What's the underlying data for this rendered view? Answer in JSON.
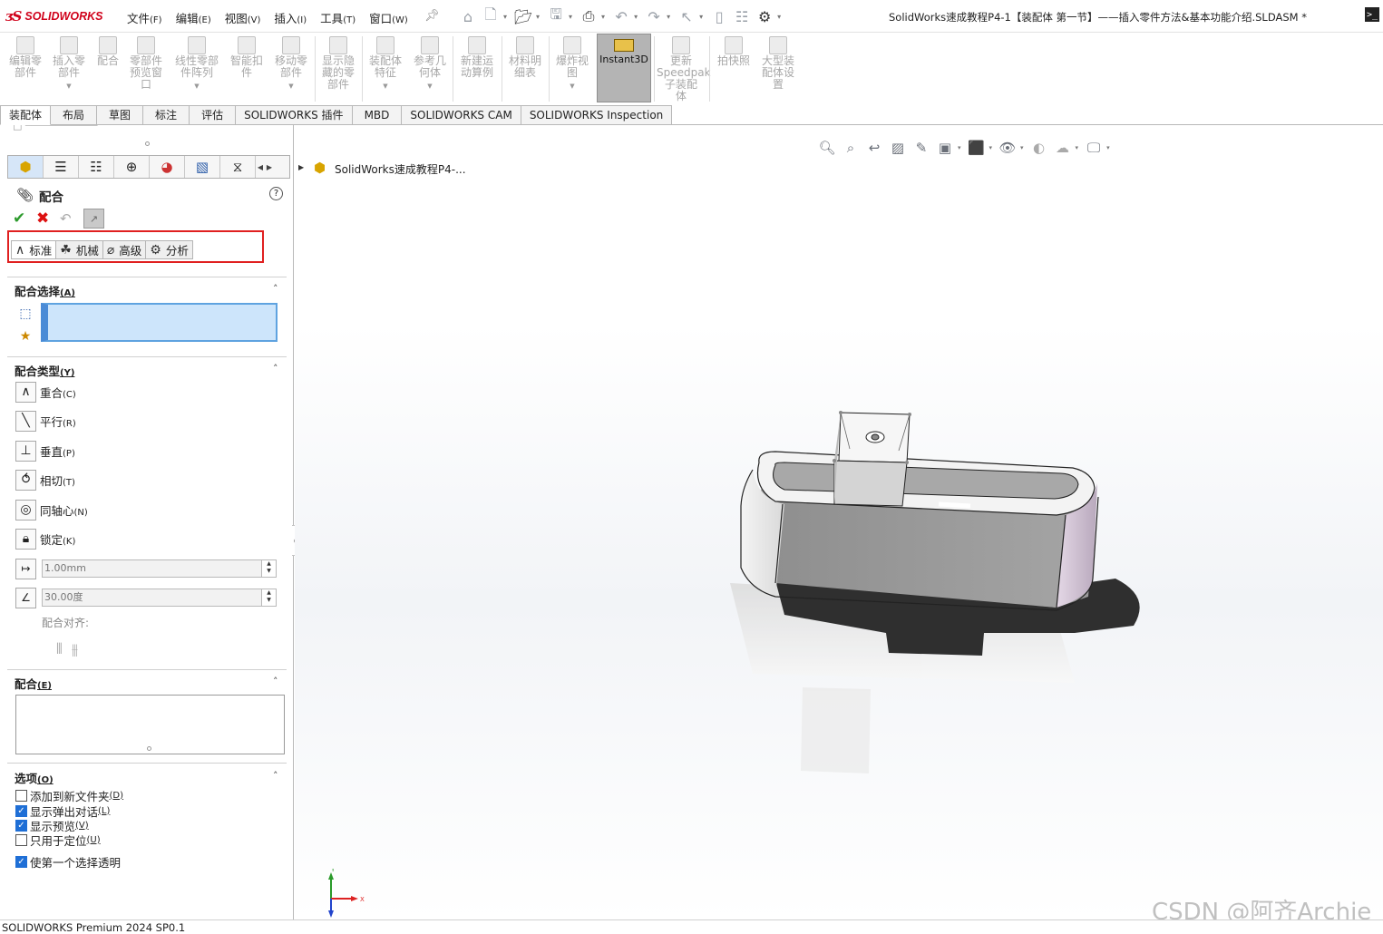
{
  "app": {
    "logo_mark": "ᴣS",
    "logo_text": "SOLIDWORKS",
    "title": "SolidWorks速成教程P4-1【装配体  第一节】——插入零件方法&基本功能介绍.SLDASM *"
  },
  "menu": {
    "items": [
      {
        "label": "文件",
        "accel": "(F)"
      },
      {
        "label": "编辑",
        "accel": "(E)"
      },
      {
        "label": "视图",
        "accel": "(V)"
      },
      {
        "label": "插入",
        "accel": "(I)"
      },
      {
        "label": "工具",
        "accel": "(T)"
      },
      {
        "label": "窗口",
        "accel": "(W)"
      }
    ]
  },
  "ribbon": {
    "buttons": [
      {
        "label": "编辑零\n部件",
        "icon": "edit-component-icon",
        "dropdown": false
      },
      {
        "label": "插入零\n部件",
        "icon": "insert-component-icon",
        "dropdown": true
      },
      {
        "label": "配合",
        "icon": "mate-icon",
        "dropdown": false
      },
      {
        "label": "零部件\n预览窗\n口",
        "icon": "component-preview-icon",
        "dropdown": false
      },
      {
        "label": "线性零部\n件阵列",
        "icon": "linear-pattern-icon",
        "dropdown": true
      },
      {
        "label": "智能扣\n件",
        "icon": "smart-fasteners-icon",
        "dropdown": false
      },
      {
        "label": "移动零\n部件",
        "icon": "move-component-icon",
        "dropdown": true
      },
      {
        "label": "显示隐\n藏的零\n部件",
        "icon": "show-hidden-icon",
        "dropdown": false
      },
      {
        "label": "装配体\n特征",
        "icon": "assembly-features-icon",
        "dropdown": true
      },
      {
        "label": "参考几\n何体",
        "icon": "reference-geometry-icon",
        "dropdown": true
      },
      {
        "label": "新建运\n动算例",
        "icon": "motion-study-icon",
        "dropdown": false
      },
      {
        "label": "材料明\n细表",
        "icon": "bom-icon",
        "dropdown": false
      },
      {
        "label": "爆炸视\n图",
        "icon": "exploded-view-icon",
        "dropdown": true
      },
      {
        "label": "Instant3D",
        "icon": "instant3d-icon",
        "dropdown": false
      },
      {
        "label": "更新\nSpeedpak\n子装配\n体",
        "icon": "speedpak-icon",
        "dropdown": false
      },
      {
        "label": "拍快照",
        "icon": "snapshot-icon",
        "dropdown": false
      },
      {
        "label": "大型装\n配体设\n置",
        "icon": "large-assembly-icon",
        "dropdown": false
      }
    ]
  },
  "tabs": [
    "装配体",
    "布局",
    "草图",
    "标注",
    "评估",
    "SOLIDWORKS 插件",
    "MBD",
    "SOLIDWORKS CAM",
    "SOLIDWORKS Inspection"
  ],
  "property_manager": {
    "title": "配合",
    "mate_tabs": [
      {
        "label": "标准",
        "icon": "standard-mates-icon"
      },
      {
        "label": "机械",
        "icon": "mechanical-mates-icon"
      },
      {
        "label": "高级",
        "icon": "advanced-mates-icon"
      },
      {
        "label": "分析",
        "icon": "analysis-icon"
      }
    ],
    "sections": {
      "selections": {
        "label": "配合选择",
        "accel": "(A)"
      },
      "mate_types": {
        "label": "配合类型",
        "accel": "(Y)"
      },
      "mates": {
        "label": "配合",
        "accel": "(E)"
      },
      "options": {
        "label": "选项",
        "accel": "(O)"
      }
    },
    "mate_types": [
      {
        "label": "重合",
        "accel": "(C)",
        "icon": "coincident-icon"
      },
      {
        "label": "平行",
        "accel": "(R)",
        "icon": "parallel-icon"
      },
      {
        "label": "垂直",
        "accel": "(P)",
        "icon": "perpendicular-icon"
      },
      {
        "label": "相切",
        "accel": "(T)",
        "icon": "tangent-icon"
      },
      {
        "label": "同轴心",
        "accel": "(N)",
        "icon": "concentric-icon"
      },
      {
        "label": "锁定",
        "accel": "(K)",
        "icon": "lock-icon"
      }
    ],
    "distance_value": "1.00mm",
    "angle_value": "30.00度",
    "mate_alignment_label": "配合对齐:",
    "options": [
      {
        "label": "添加到新文件夹",
        "accel": "(D)",
        "checked": false
      },
      {
        "label": "显示弹出对话",
        "accel": "(L)",
        "checked": true
      },
      {
        "label": "显示预览",
        "accel": "(V)",
        "checked": true
      },
      {
        "label": "只用于定位",
        "accel": "(U)",
        "checked": false
      },
      {
        "label": "使第一个选择透明",
        "accel": "",
        "checked": true
      }
    ]
  },
  "graphics": {
    "tree_label": "SolidWorks速成教程P4-...",
    "triad": {
      "y": "Y",
      "x": "X"
    },
    "watermark": "CSDN @阿齐Archie"
  },
  "status": {
    "text": "SOLIDWORKS Premium 2024 SP0.1"
  },
  "colors": {
    "brand_red": "#d0021b",
    "selection_blue": "#cde5fb",
    "highlight_red": "#e02020",
    "ok_green": "#2e9b2e"
  }
}
